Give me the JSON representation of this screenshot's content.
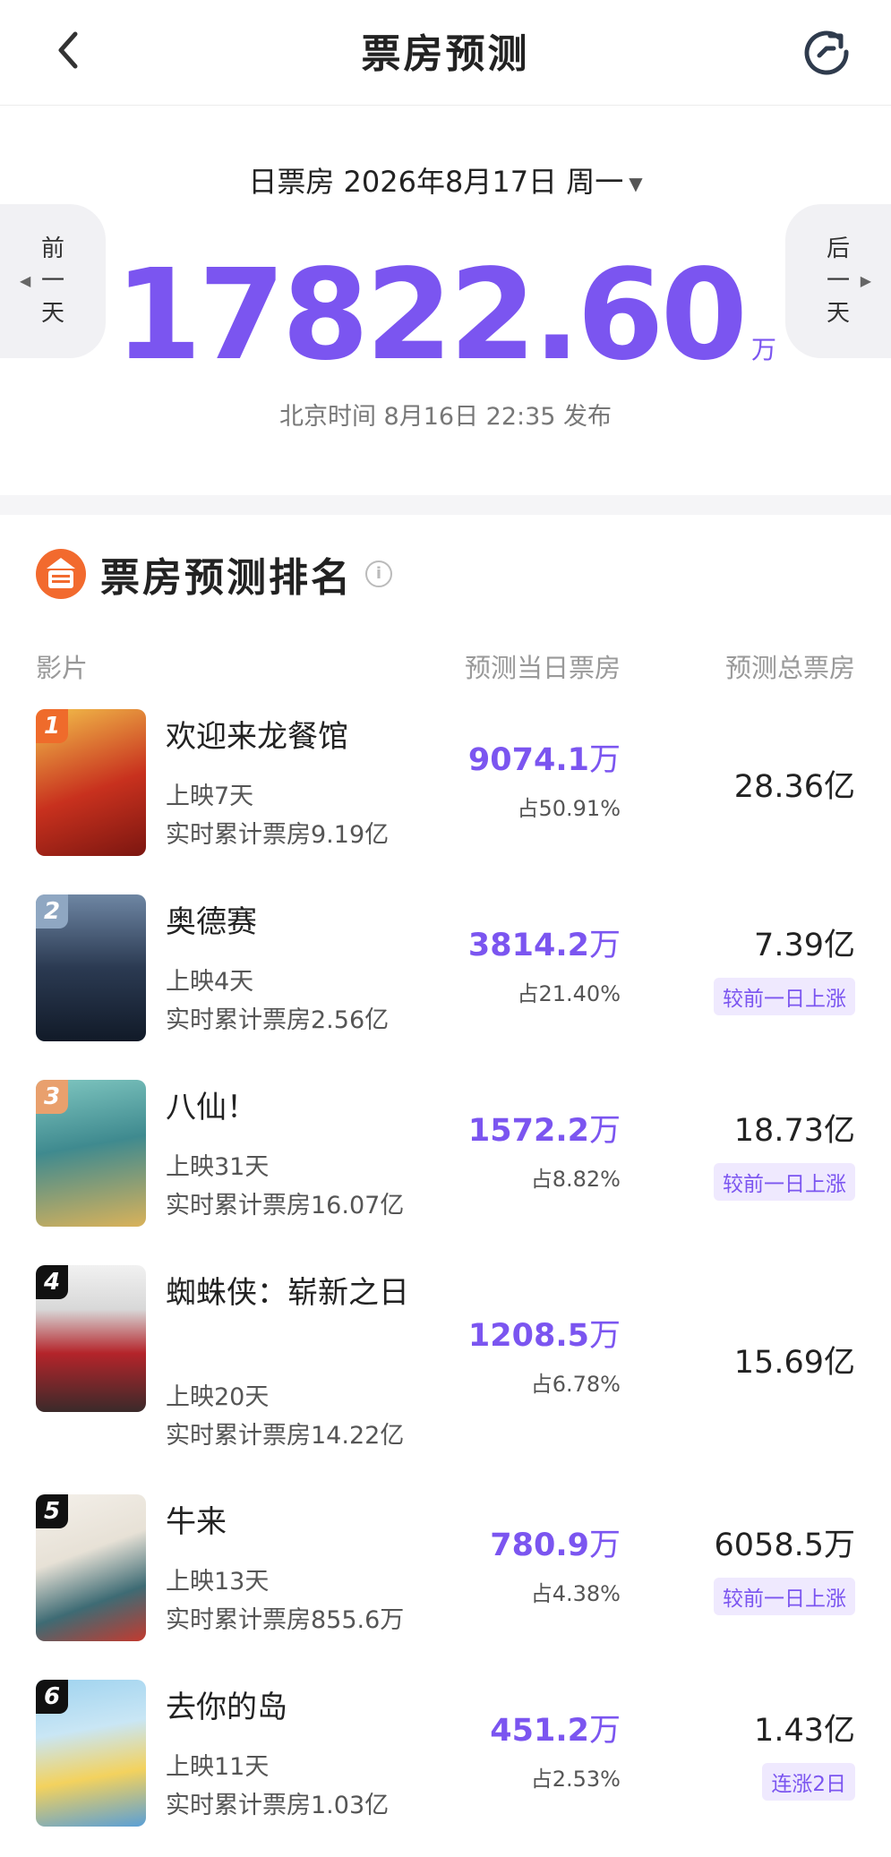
{
  "header": {
    "title": "票房预测"
  },
  "summary": {
    "date_label": "日票房 2026年8月17日 周一",
    "prev_day": [
      "前",
      "一",
      "天"
    ],
    "next_day": [
      "后",
      "一",
      "天"
    ],
    "total_value": "17822.60",
    "total_unit": "万",
    "publish_info": "北京时间 8月16日 22:35 发布"
  },
  "ranking": {
    "title": "票房预测排名",
    "columns": {
      "film": "影片",
      "day_box": "预测当日票房",
      "total_box": "预测总票房"
    },
    "movies": [
      {
        "rank": "1",
        "name": "欢迎来龙餐馆",
        "days": "上映7天",
        "cumulative": "实时累计票房9.19亿",
        "day_value": "9074.1",
        "day_unit": "万",
        "share": "占50.91%",
        "total": "28.36",
        "total_unit": "亿",
        "trend": "",
        "badge_color": "#ef6b2b",
        "poster_colors": [
          "#c8311e",
          "#f3c14b"
        ]
      },
      {
        "rank": "2",
        "name": "奥德赛",
        "days": "上映4天",
        "cumulative": "实时累计票房2.56亿",
        "day_value": "3814.2",
        "day_unit": "万",
        "share": "占21.40%",
        "total": "7.39",
        "total_unit": "亿",
        "trend": "较前一日上涨",
        "badge_color": "#8fa7c2",
        "poster_colors": [
          "#1d2a3f",
          "#6e86a3"
        ]
      },
      {
        "rank": "3",
        "name": "八仙！",
        "days": "上映31天",
        "cumulative": "实时累计票房16.07亿",
        "day_value": "1572.2",
        "day_unit": "万",
        "share": "占8.82%",
        "total": "18.73",
        "total_unit": "亿",
        "trend": "较前一日上涨",
        "badge_color": "#e9a06d",
        "poster_colors": [
          "#3f8a8f",
          "#d9b25a"
        ]
      },
      {
        "rank": "4",
        "name": "蜘蛛侠：崭新之日",
        "days": "上映20天",
        "cumulative": "实时累计票房14.22亿",
        "day_value": "1208.5",
        "day_unit": "万",
        "share": "占6.78%",
        "total": "15.69",
        "total_unit": "亿",
        "trend": "",
        "badge_color": "#111111",
        "poster_colors": [
          "#f1f1f1",
          "#b4242a"
        ]
      },
      {
        "rank": "5",
        "name": "牛来",
        "days": "上映13天",
        "cumulative": "实时累计票房855.6万",
        "day_value": "780.9",
        "day_unit": "万",
        "share": "占4.38%",
        "total": "6058.5",
        "total_unit": "万",
        "trend": "较前一日上涨",
        "badge_color": "#111111",
        "poster_colors": [
          "#f4f0ea",
          "#3e6b74"
        ]
      },
      {
        "rank": "6",
        "name": "去你的岛",
        "days": "上映11天",
        "cumulative": "实时累计票房1.03亿",
        "day_value": "451.2",
        "day_unit": "万",
        "share": "占2.53%",
        "total": "1.43",
        "total_unit": "亿",
        "trend": "连涨2日",
        "badge_color": "#111111",
        "poster_colors": [
          "#9fd3ef",
          "#f3d25e"
        ]
      }
    ]
  },
  "colors": {
    "accent": "#7b55f0",
    "tag_bg": "#efe9fe",
    "logo_orange": "#f26a2e"
  },
  "icons": {
    "back": "chevron-left-icon",
    "refresh": "refresh-icon",
    "logo": "film-logo-icon",
    "info": "info-icon"
  }
}
